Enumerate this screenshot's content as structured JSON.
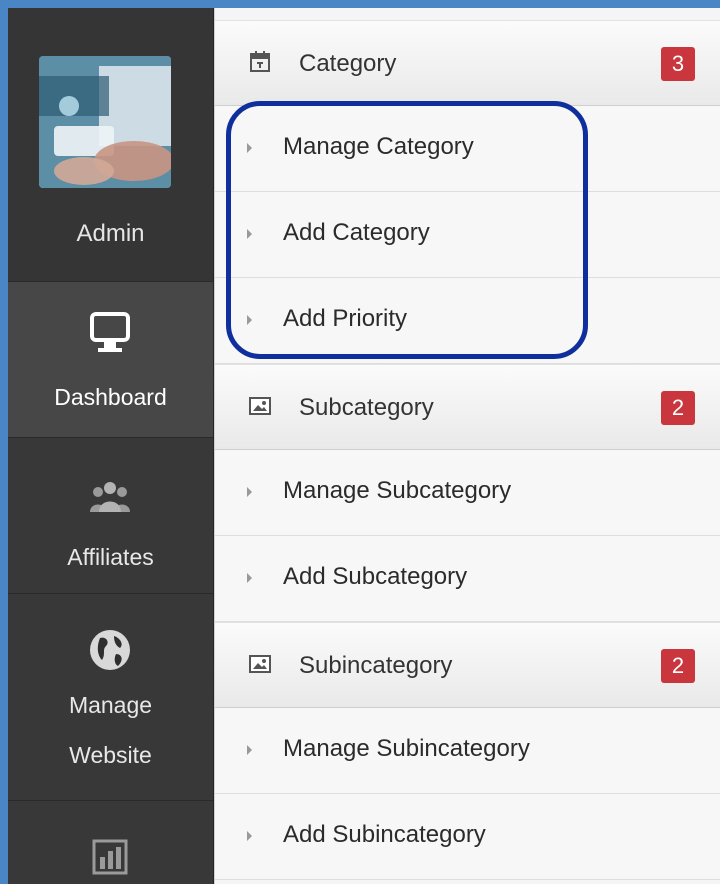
{
  "sidebar": {
    "profile": {
      "name": "Admin"
    },
    "items": [
      {
        "label": "Dashboard",
        "icon": "monitor-icon",
        "active": true
      },
      {
        "label": "Affiliates",
        "icon": "users-icon"
      },
      {
        "label_line1": "Manage",
        "label_line2": "Website",
        "icon": "globe-icon"
      },
      {
        "label": "",
        "icon": "bar-chart-icon"
      }
    ]
  },
  "panel": {
    "groups": [
      {
        "label": "Category",
        "icon": "calendar-icon",
        "badge": "3",
        "items": [
          "Manage Category",
          "Add Category",
          "Add Priority"
        ]
      },
      {
        "label": "Subcategory",
        "icon": "image-icon",
        "badge": "2",
        "items": [
          "Manage Subcategory",
          "Add Subcategory"
        ]
      },
      {
        "label": "Subincategory",
        "icon": "image-icon",
        "badge": "2",
        "items": [
          "Manage Subincategory",
          "Add Subincategory"
        ]
      }
    ]
  },
  "colors": {
    "badge": "#c9363e",
    "highlight_border": "#0e2f9c",
    "sidebar_bg": "#383838",
    "outer_bg": "#4a86c5"
  }
}
